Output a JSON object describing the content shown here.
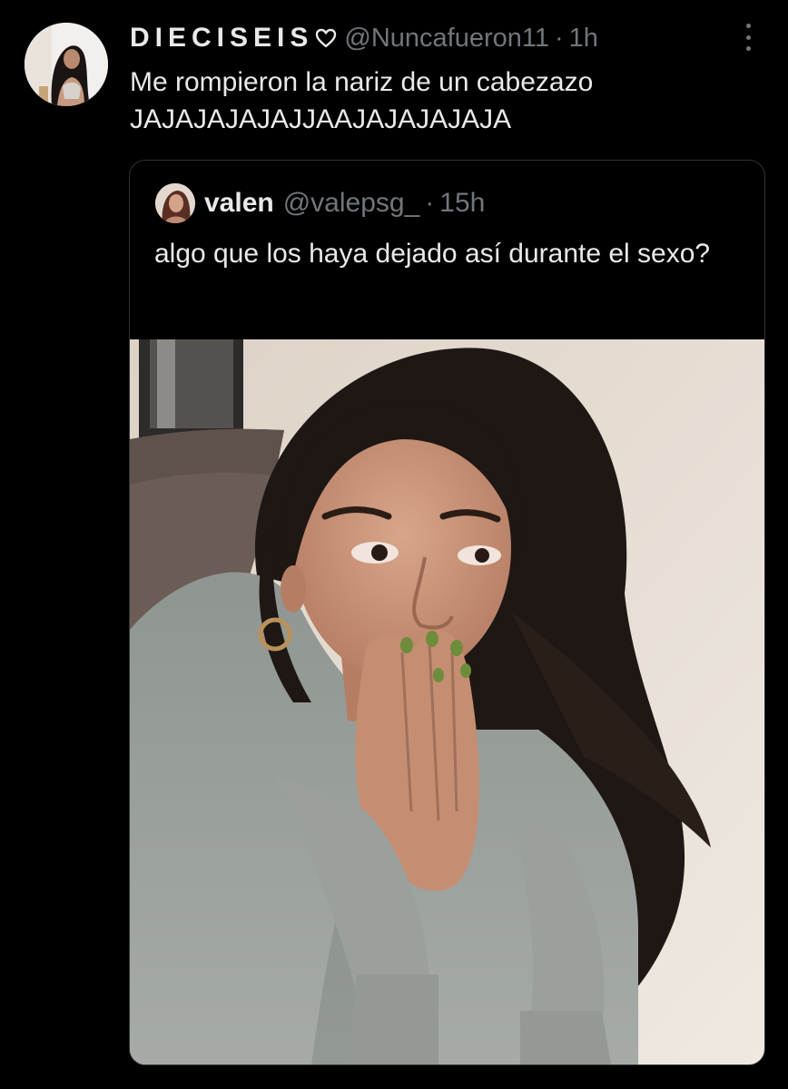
{
  "tweet": {
    "display_name": "DIECISEIS",
    "handle": "@Nuncafueron11",
    "separator": "·",
    "time": "1h",
    "text": "Me rompieron la nariz de un cabezazo JAJAJAJAJAJJAAJAJAJAJAJA",
    "icons": [
      "avatar-photo",
      "heart-outline-icon",
      "more-vertical-icon"
    ]
  },
  "quoted_tweet": {
    "display_name": "valen",
    "handle": "@valepsg_",
    "separator": "·",
    "time": "15h",
    "text": "algo que los haya dejado así durante el sexo?",
    "photo": "photo of a young woman with long dark hair in a grey sweatshirt, hands pressed over her mouth, looking surprised"
  },
  "colors": {
    "background": "#000000",
    "primary_text": "#e7e9ea",
    "secondary_text": "#71767b",
    "border": "#2f3336"
  }
}
